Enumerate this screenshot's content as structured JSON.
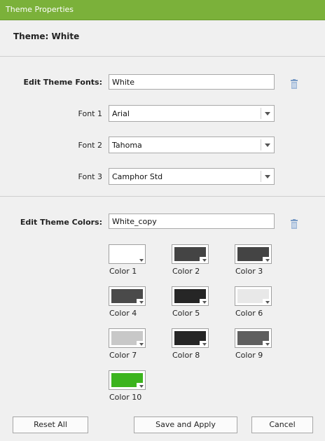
{
  "window": {
    "title": "Theme Properties"
  },
  "header": {
    "label": "Theme: White"
  },
  "fonts": {
    "label": "Edit Theme Fonts:",
    "name_value": "White",
    "items": [
      {
        "label": "Font 1",
        "value": "Arial"
      },
      {
        "label": "Font 2",
        "value": "Tahoma"
      },
      {
        "label": "Font 3",
        "value": "Camphor Std"
      }
    ]
  },
  "colors": {
    "label": "Edit Theme Colors:",
    "name_value": "White_copy",
    "items": [
      {
        "label": "Color 1",
        "color": "#ffffff"
      },
      {
        "label": "Color 2",
        "color": "#444444"
      },
      {
        "label": "Color 3",
        "color": "#444444"
      },
      {
        "label": "Color 4",
        "color": "#4a4a4a"
      },
      {
        "label": "Color 5",
        "color": "#262626"
      },
      {
        "label": "Color 6",
        "color": "#e8e8e8"
      },
      {
        "label": "Color 7",
        "color": "#c8c8c8"
      },
      {
        "label": "Color 8",
        "color": "#262626"
      },
      {
        "label": "Color 9",
        "color": "#5f5f5f"
      },
      {
        "label": "Color 10",
        "color": "#3cb41e"
      }
    ]
  },
  "buttons": {
    "reset": "Reset All",
    "save": "Save and Apply",
    "cancel": "Cancel"
  },
  "theme": {
    "titlebar": "#7bb13a",
    "icon": "#7a9cc6"
  }
}
